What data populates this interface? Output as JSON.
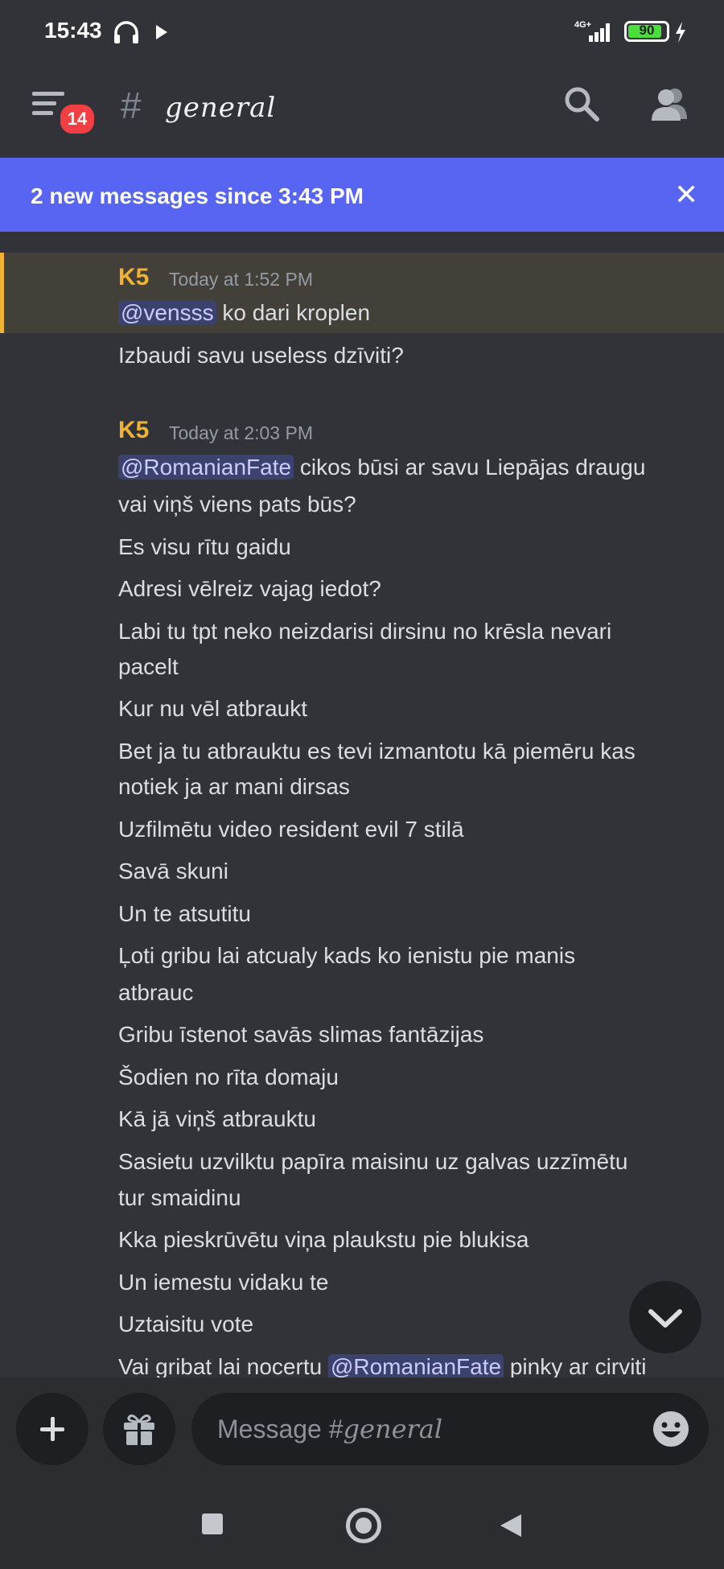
{
  "status_bar": {
    "time": "15:43",
    "network": "4G+",
    "battery": "90",
    "battery_level": 0.9,
    "icons": [
      "headphones-icon",
      "play-icon",
      "signal-icon",
      "battery-icon",
      "bolt-icon"
    ]
  },
  "header": {
    "badge_count": "14",
    "hash": "#",
    "channel_name": "general",
    "icons": [
      "menu-icon",
      "search-icon",
      "members-icon"
    ]
  },
  "banner": {
    "text": "2 new messages since 3:43 PM",
    "close": "✕"
  },
  "messages": {
    "group1": {
      "author": "K5",
      "timestamp": "Today at 1:52 PM",
      "line1_mention": "@vensss",
      "line1_text": " ko dari kroplen",
      "line2": "Izbaudi savu useless dzīviti?"
    },
    "group2": {
      "author": "K5",
      "timestamp": "Today at 2:03 PM",
      "line1_mention": "@RomanianFate",
      "line1_text": " cikos būsi ar savu Liepājas draugu",
      "line1b": "vai viņš viens pats būs?",
      "lines": [
        "Es visu rītu gaidu",
        "Adresi vēlreiz vajag iedot?",
        "Labi tu tpt neko neizdarisi dirsinu no krēsla nevari",
        "pacelt",
        "Kur nu vēl atbraukt",
        "Bet ja tu atbrauktu es tevi izmantotu kā piemēru kas",
        "notiek ja ar mani dirsas",
        "Uzfilmētu video resident evil 7 stilā",
        "Savā skuni",
        "Un te atsutitu",
        "Ļoti gribu lai atcualy kads ko ienistu pie manis",
        "atbrauc",
        "Gribu īstenot savās slimas fantāzijas",
        "Šodien no rīta domaju",
        "Kā jā viņš atbrauktu",
        "Sasietu uzvilktu papīra maisinu uz galvas uzzīmētu",
        "tur smaidinu",
        "Kka pieskrūvētu viņa plaukstu pie blukisa",
        "Un iemestu vidaku te",
        "Uztaisitu vote"
      ],
      "last_line_before": "Vai gribat lai nocertu ",
      "last_line_mention": "@RomanianFate",
      "last_line_after": " pinky ar cirviti"
    }
  },
  "composer": {
    "placeholder_prefix": "Message #",
    "placeholder_channel": "general"
  }
}
